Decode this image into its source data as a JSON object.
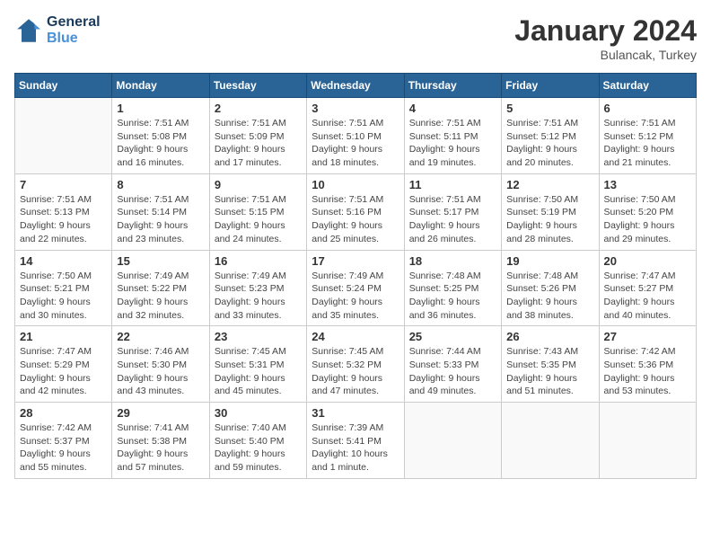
{
  "header": {
    "logo_line1": "General",
    "logo_line2": "Blue",
    "month": "January 2024",
    "location": "Bulancak, Turkey"
  },
  "columns": [
    "Sunday",
    "Monday",
    "Tuesday",
    "Wednesday",
    "Thursday",
    "Friday",
    "Saturday"
  ],
  "weeks": [
    [
      {
        "day": "",
        "info": ""
      },
      {
        "day": "1",
        "info": "Sunrise: 7:51 AM\nSunset: 5:08 PM\nDaylight: 9 hours\nand 16 minutes."
      },
      {
        "day": "2",
        "info": "Sunrise: 7:51 AM\nSunset: 5:09 PM\nDaylight: 9 hours\nand 17 minutes."
      },
      {
        "day": "3",
        "info": "Sunrise: 7:51 AM\nSunset: 5:10 PM\nDaylight: 9 hours\nand 18 minutes."
      },
      {
        "day": "4",
        "info": "Sunrise: 7:51 AM\nSunset: 5:11 PM\nDaylight: 9 hours\nand 19 minutes."
      },
      {
        "day": "5",
        "info": "Sunrise: 7:51 AM\nSunset: 5:12 PM\nDaylight: 9 hours\nand 20 minutes."
      },
      {
        "day": "6",
        "info": "Sunrise: 7:51 AM\nSunset: 5:12 PM\nDaylight: 9 hours\nand 21 minutes."
      }
    ],
    [
      {
        "day": "7",
        "info": "Sunrise: 7:51 AM\nSunset: 5:13 PM\nDaylight: 9 hours\nand 22 minutes."
      },
      {
        "day": "8",
        "info": "Sunrise: 7:51 AM\nSunset: 5:14 PM\nDaylight: 9 hours\nand 23 minutes."
      },
      {
        "day": "9",
        "info": "Sunrise: 7:51 AM\nSunset: 5:15 PM\nDaylight: 9 hours\nand 24 minutes."
      },
      {
        "day": "10",
        "info": "Sunrise: 7:51 AM\nSunset: 5:16 PM\nDaylight: 9 hours\nand 25 minutes."
      },
      {
        "day": "11",
        "info": "Sunrise: 7:51 AM\nSunset: 5:17 PM\nDaylight: 9 hours\nand 26 minutes."
      },
      {
        "day": "12",
        "info": "Sunrise: 7:50 AM\nSunset: 5:19 PM\nDaylight: 9 hours\nand 28 minutes."
      },
      {
        "day": "13",
        "info": "Sunrise: 7:50 AM\nSunset: 5:20 PM\nDaylight: 9 hours\nand 29 minutes."
      }
    ],
    [
      {
        "day": "14",
        "info": "Sunrise: 7:50 AM\nSunset: 5:21 PM\nDaylight: 9 hours\nand 30 minutes."
      },
      {
        "day": "15",
        "info": "Sunrise: 7:49 AM\nSunset: 5:22 PM\nDaylight: 9 hours\nand 32 minutes."
      },
      {
        "day": "16",
        "info": "Sunrise: 7:49 AM\nSunset: 5:23 PM\nDaylight: 9 hours\nand 33 minutes."
      },
      {
        "day": "17",
        "info": "Sunrise: 7:49 AM\nSunset: 5:24 PM\nDaylight: 9 hours\nand 35 minutes."
      },
      {
        "day": "18",
        "info": "Sunrise: 7:48 AM\nSunset: 5:25 PM\nDaylight: 9 hours\nand 36 minutes."
      },
      {
        "day": "19",
        "info": "Sunrise: 7:48 AM\nSunset: 5:26 PM\nDaylight: 9 hours\nand 38 minutes."
      },
      {
        "day": "20",
        "info": "Sunrise: 7:47 AM\nSunset: 5:27 PM\nDaylight: 9 hours\nand 40 minutes."
      }
    ],
    [
      {
        "day": "21",
        "info": "Sunrise: 7:47 AM\nSunset: 5:29 PM\nDaylight: 9 hours\nand 42 minutes."
      },
      {
        "day": "22",
        "info": "Sunrise: 7:46 AM\nSunset: 5:30 PM\nDaylight: 9 hours\nand 43 minutes."
      },
      {
        "day": "23",
        "info": "Sunrise: 7:45 AM\nSunset: 5:31 PM\nDaylight: 9 hours\nand 45 minutes."
      },
      {
        "day": "24",
        "info": "Sunrise: 7:45 AM\nSunset: 5:32 PM\nDaylight: 9 hours\nand 47 minutes."
      },
      {
        "day": "25",
        "info": "Sunrise: 7:44 AM\nSunset: 5:33 PM\nDaylight: 9 hours\nand 49 minutes."
      },
      {
        "day": "26",
        "info": "Sunrise: 7:43 AM\nSunset: 5:35 PM\nDaylight: 9 hours\nand 51 minutes."
      },
      {
        "day": "27",
        "info": "Sunrise: 7:42 AM\nSunset: 5:36 PM\nDaylight: 9 hours\nand 53 minutes."
      }
    ],
    [
      {
        "day": "28",
        "info": "Sunrise: 7:42 AM\nSunset: 5:37 PM\nDaylight: 9 hours\nand 55 minutes."
      },
      {
        "day": "29",
        "info": "Sunrise: 7:41 AM\nSunset: 5:38 PM\nDaylight: 9 hours\nand 57 minutes."
      },
      {
        "day": "30",
        "info": "Sunrise: 7:40 AM\nSunset: 5:40 PM\nDaylight: 9 hours\nand 59 minutes."
      },
      {
        "day": "31",
        "info": "Sunrise: 7:39 AM\nSunset: 5:41 PM\nDaylight: 10 hours\nand 1 minute."
      },
      {
        "day": "",
        "info": ""
      },
      {
        "day": "",
        "info": ""
      },
      {
        "day": "",
        "info": ""
      }
    ]
  ]
}
